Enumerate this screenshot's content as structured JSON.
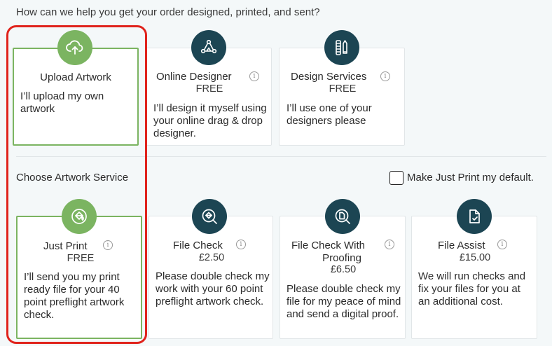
{
  "heading": "How can we help you get your order designed, printed, and sent?",
  "design_options": [
    {
      "title": "Upload Artwork",
      "price": "",
      "desc": "I’ll upload my own artwork",
      "icon": "cloud-upload-icon",
      "selected": true
    },
    {
      "title": "Online Designer",
      "price": "FREE",
      "desc": "I’ll design it myself using your online drag & drop designer.",
      "icon": "design-nodes-icon",
      "selected": false
    },
    {
      "title": "Design Services",
      "price": "FREE",
      "desc": "I’ll use one of your designers please",
      "icon": "pencil-ruler-icon",
      "selected": false
    }
  ],
  "artwork_section": {
    "label": "Choose Artwork Service",
    "default_checkbox_label": "Make Just Print my default.",
    "default_checked": false
  },
  "artwork_options": [
    {
      "title": "Just Print",
      "price": "FREE",
      "desc": "I’ll send you my print ready file for your 40 point preflight artwork check.",
      "icon": "paint-bucket-icon",
      "selected": true
    },
    {
      "title": "File Check",
      "price": "£2.50",
      "desc": "Please double check my work with your 60 point preflight artwork check.",
      "icon": "paint-bucket-search-icon",
      "selected": false
    },
    {
      "title_line1": "File Check With",
      "title_line2": "Proofing",
      "price": "£6.50",
      "desc": "Please double check my file for my peace of mind and send a digital proof.",
      "icon": "document-search-icon",
      "selected": false
    },
    {
      "title": "File Assist",
      "price": "£15.00",
      "desc": "We will run checks and fix your files for you at an additional cost.",
      "icon": "document-check-icon",
      "selected": false
    }
  ],
  "info_glyph": "i",
  "colors": {
    "accent_green": "#7bb461",
    "dark_teal": "#1c4553",
    "highlight_red": "#e0231c"
  }
}
